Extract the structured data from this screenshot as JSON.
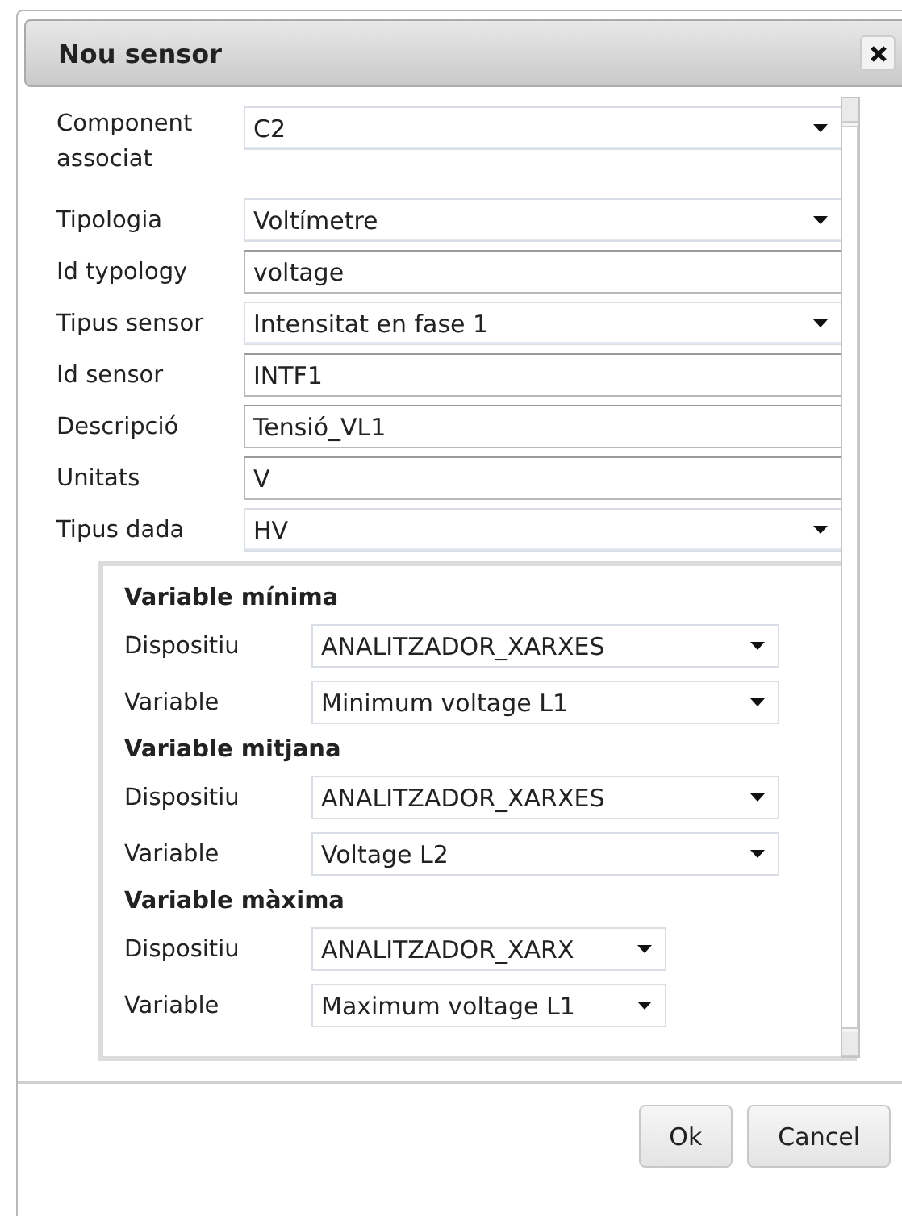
{
  "dialog": {
    "title": "Nou sensor"
  },
  "fields": [
    {
      "label": "Component associat",
      "kind": "select",
      "value": "C2"
    },
    {
      "label": "Tipologia",
      "kind": "select",
      "value": "Voltímetre"
    },
    {
      "label": "Id typology",
      "kind": "text",
      "value": "voltage"
    },
    {
      "label": "Tipus sensor",
      "kind": "select",
      "value": "Intensitat en fase 1"
    },
    {
      "label": "Id sensor",
      "kind": "text",
      "value": "INTF1"
    },
    {
      "label": "Descripció",
      "kind": "text",
      "value": "Tensió_VL1"
    },
    {
      "label": "Unitats",
      "kind": "text",
      "value": "V"
    },
    {
      "label": "Tipus dada",
      "kind": "select",
      "value": "HV"
    }
  ],
  "variable_groups": [
    {
      "title": "Variable mínima",
      "rows": [
        {
          "label": "Dispositiu",
          "value": "ANALITZADOR_XARXES"
        },
        {
          "label": "Variable",
          "value": "Minimum voltage L1"
        }
      ]
    },
    {
      "title": "Variable mitjana",
      "rows": [
        {
          "label": "Dispositiu",
          "value": "ANALITZADOR_XARXES"
        },
        {
          "label": "Variable",
          "value": "Voltage L2"
        }
      ]
    },
    {
      "title": "Variable màxima",
      "rows": [
        {
          "label": "Dispositiu",
          "value": "ANALITZADOR_XARX"
        },
        {
          "label": "Variable",
          "value": "Maximum voltage L1"
        }
      ]
    }
  ],
  "buttons": [
    "Ok",
    "Cancel"
  ]
}
